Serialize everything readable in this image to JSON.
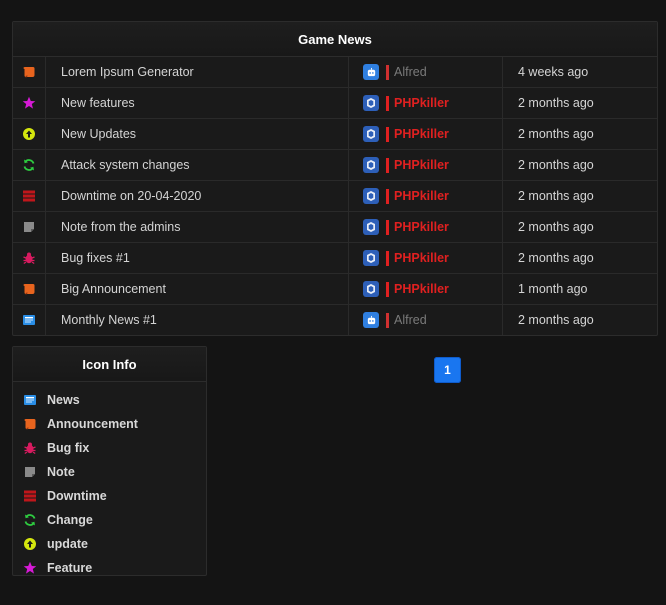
{
  "news": {
    "title": "Game News",
    "rows": [
      {
        "type": "announcement",
        "title": "Lorem Ipsum Generator",
        "author": "Alfred",
        "author_kind": "alfred",
        "time": "4 weeks ago"
      },
      {
        "type": "feature",
        "title": "New features",
        "author": "PHPkiller",
        "author_kind": "php",
        "time": "2 months ago"
      },
      {
        "type": "update",
        "title": "New Updates",
        "author": "PHPkiller",
        "author_kind": "php",
        "time": "2 months ago"
      },
      {
        "type": "change",
        "title": "Attack system changes",
        "author": "PHPkiller",
        "author_kind": "php",
        "time": "2 months ago"
      },
      {
        "type": "downtime",
        "title": "Downtime on 20-04-2020",
        "author": "PHPkiller",
        "author_kind": "php",
        "time": "2 months ago"
      },
      {
        "type": "note",
        "title": "Note from the admins",
        "author": "PHPkiller",
        "author_kind": "php",
        "time": "2 months ago"
      },
      {
        "type": "bugfix",
        "title": "Bug fixes #1",
        "author": "PHPkiller",
        "author_kind": "php",
        "time": "2 months ago"
      },
      {
        "type": "announcement",
        "title": "Big Announcement",
        "author": "PHPkiller",
        "author_kind": "php",
        "time": "1 month ago"
      },
      {
        "type": "news",
        "title": "Monthly News #1",
        "author": "Alfred",
        "author_kind": "alfred",
        "time": "2 months ago"
      }
    ]
  },
  "icon_info": {
    "title": "Icon Info",
    "items": [
      {
        "type": "news",
        "label": "News"
      },
      {
        "type": "announcement",
        "label": "Announcement"
      },
      {
        "type": "bugfix",
        "label": "Bug fix"
      },
      {
        "type": "note",
        "label": "Note"
      },
      {
        "type": "downtime",
        "label": "Downtime"
      },
      {
        "type": "change",
        "label": "Change"
      },
      {
        "type": "update",
        "label": "update"
      },
      {
        "type": "feature",
        "label": "Feature"
      }
    ]
  },
  "pagination": {
    "current": "1"
  },
  "icons": {
    "news": {
      "name": "newspaper-icon",
      "color": "#2a8ee6"
    },
    "announcement": {
      "name": "scroll-icon",
      "color": "#e8641e"
    },
    "bugfix": {
      "name": "bug-icon",
      "color": "#d81b60"
    },
    "note": {
      "name": "note-icon",
      "color": "#8a8a8a"
    },
    "downtime": {
      "name": "server-icon",
      "color": "#c0161b"
    },
    "change": {
      "name": "sync-icon",
      "color": "#2ecc40"
    },
    "update": {
      "name": "arrow-up-circle-icon",
      "color": "#d4e60e"
    },
    "feature": {
      "name": "star-icon",
      "color": "#d61ad6"
    }
  },
  "colors": {
    "accent": "#1976f0",
    "php_name": "#e02020",
    "alfred_name": "#7a7a7a"
  }
}
